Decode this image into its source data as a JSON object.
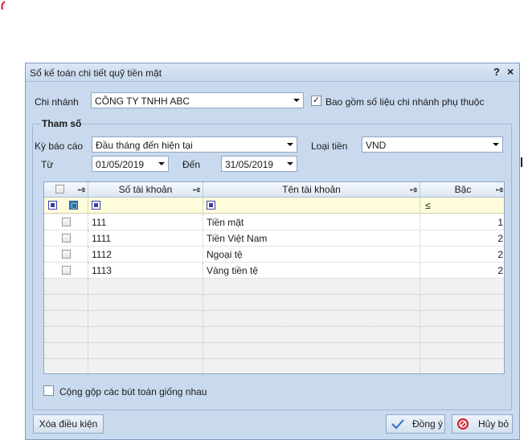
{
  "dialog": {
    "title": "Sổ kế toán chi tiết quỹ tiền mặt",
    "help_glyph": "?",
    "close_glyph": "×"
  },
  "branch": {
    "label": "Chi nhánh",
    "value": "CÔNG TY TNHH ABC",
    "include_sub_label": "Bao gồm số liệu chi nhánh phụ thuộc",
    "include_sub_checked": true,
    "check_glyph": "✓"
  },
  "params": {
    "group_title": "Tham số",
    "period_label": "Kỳ báo cáo",
    "period_value": "Đầu tháng đến hiện tại",
    "currency_label": "Loại tiền",
    "currency_value": "VND",
    "from_label": "Từ",
    "from_value": "01/05/2019",
    "to_label": "Đến",
    "to_value": "31/05/2019"
  },
  "grid": {
    "columns": [
      "Số tài khoản",
      "Tên tài khoản",
      "Bậc"
    ],
    "filter_le": "≤",
    "rows": [
      {
        "account_no": "111",
        "account_name": "Tiền mặt",
        "level": "1"
      },
      {
        "account_no": "1111",
        "account_name": "Tiền Việt Nam",
        "level": "2"
      },
      {
        "account_no": "1112",
        "account_name": "Ngoại tệ",
        "level": "2"
      },
      {
        "account_no": "1113",
        "account_name": "Vàng tiền tệ",
        "level": "2"
      }
    ]
  },
  "options": {
    "merge_label": "Cộng gộp các bút toán giống nhau"
  },
  "buttons": {
    "clear": "Xóa điều kiện",
    "ok": "Đồng ý",
    "cancel": "Hủy bỏ"
  },
  "colors": {
    "dialog_bg": "#c9daee",
    "filter_row": "#fffcdc",
    "cancel_icon": "#d0202a",
    "ok_icon": "#2a6fc9"
  },
  "icons": {
    "ok": "check-icon",
    "cancel": "forbidden-icon",
    "dropdown": "chevron-down-icon",
    "pin": "pin-icon"
  }
}
